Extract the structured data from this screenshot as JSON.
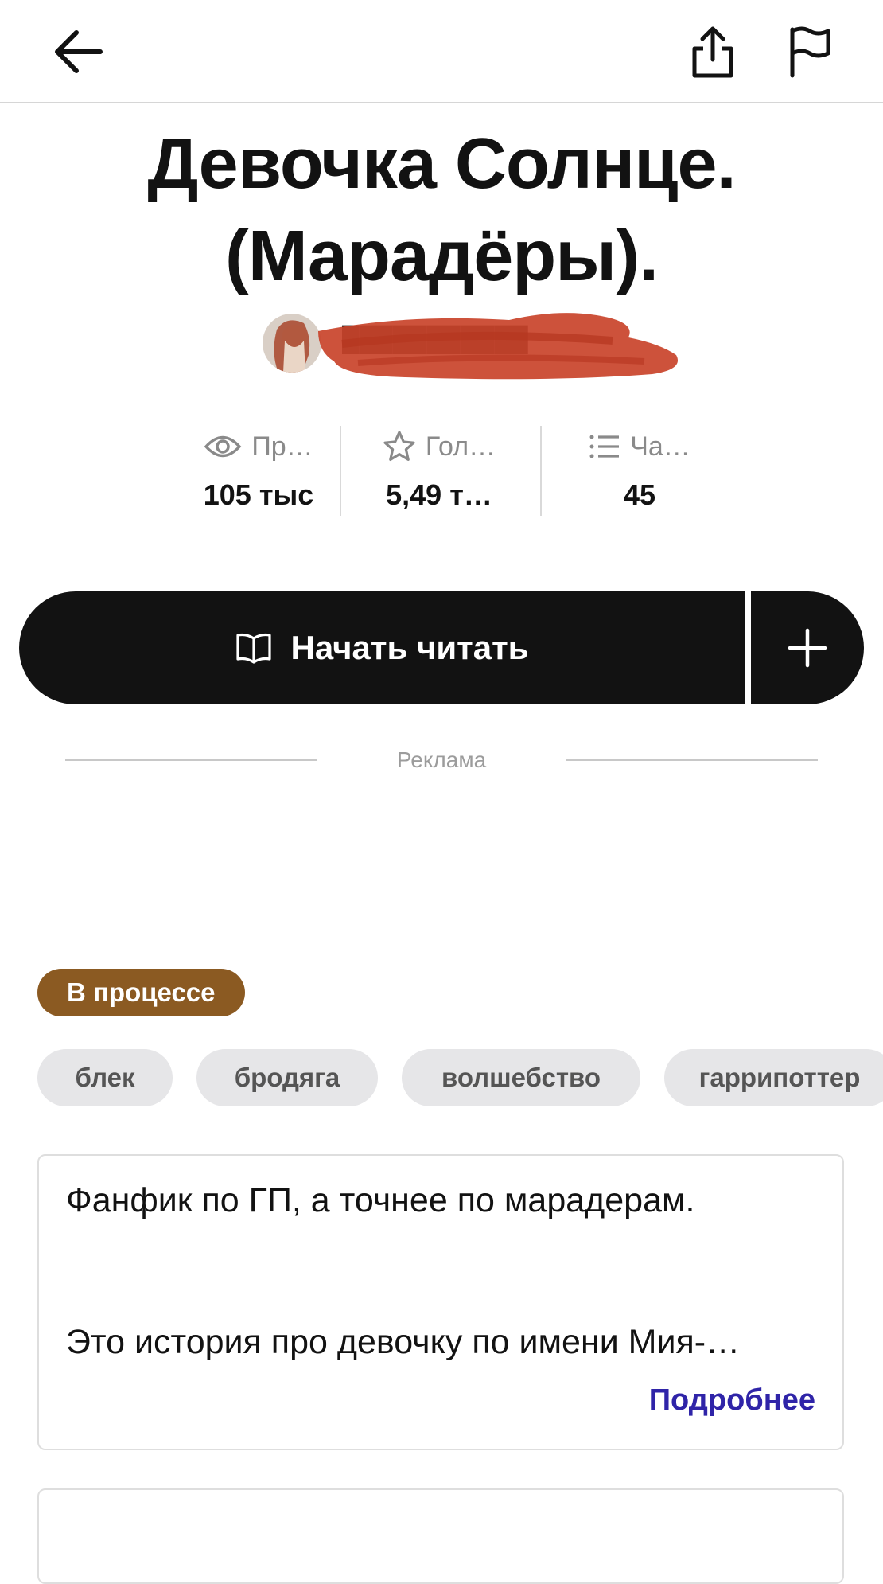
{
  "title": "Девочка Солнце. (Марадёры).",
  "author": {
    "name": "███████████"
  },
  "stats": [
    {
      "icon": "eye-icon",
      "label": "Пр…",
      "value": "105 тыс"
    },
    {
      "icon": "star-icon",
      "label": "Гол…",
      "value": "5,49 т…"
    },
    {
      "icon": "list-icon",
      "label": "Ча…",
      "value": "45"
    }
  ],
  "actions": {
    "read_label": "Начать читать",
    "add_label": "+"
  },
  "ad_label": "Реклама",
  "status": "В процессе",
  "tags": [
    "блек",
    "бродяга",
    "волшебство",
    "гаррипоттер"
  ],
  "description": {
    "line1": "Фанфик по ГП, а точнее по марадерам.",
    "line2": "Это история про девочку по имени Мия-…",
    "more_label": "Подробнее"
  },
  "colors": {
    "status_badge": "#8b5a22",
    "link": "#2f24a8",
    "primary_button": "#121212",
    "tag_bg": "#e6e6e8"
  }
}
